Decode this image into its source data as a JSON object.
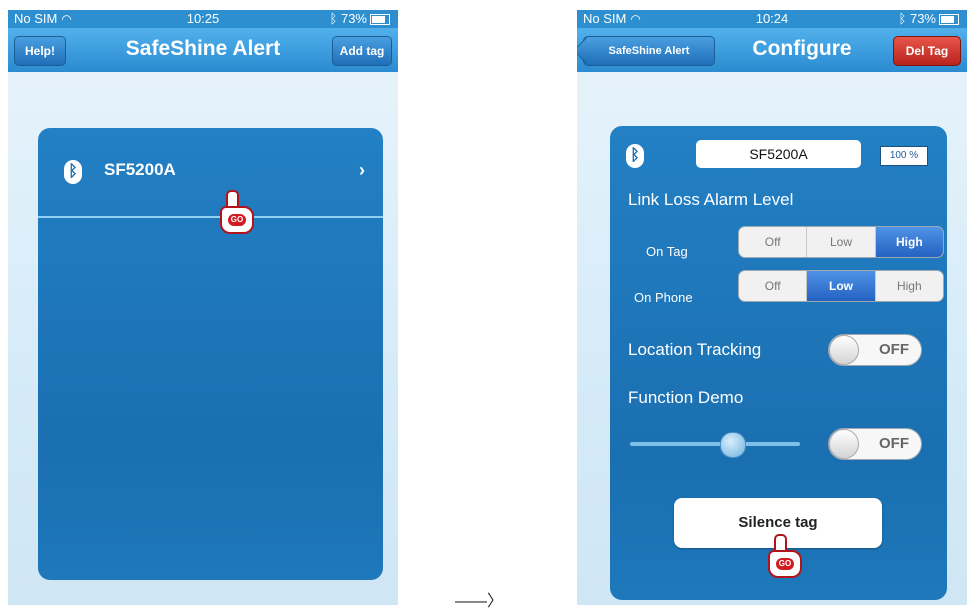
{
  "left_screen": {
    "status": {
      "carrier": "No SIM",
      "time": "10:25",
      "battery": "73%"
    },
    "nav": {
      "help_label": "Help!",
      "title": "SafeShine Alert",
      "add_label": "Add tag"
    },
    "tags": [
      {
        "name": "SF5200A"
      }
    ],
    "pointer_label": "GO"
  },
  "right_screen": {
    "status": {
      "carrier": "No SIM",
      "time": "10:24",
      "battery": "73%"
    },
    "nav": {
      "back_label": "SafeShine Alert",
      "title": "Configure",
      "del_label": "Del Tag"
    },
    "tag_name": "SF5200A",
    "battery_level": "100 %",
    "link_loss_title": "Link Loss Alarm Level",
    "on_tag_label": "On Tag",
    "on_phone_label": "On Phone",
    "segment_options": [
      "Off",
      "Low",
      "High"
    ],
    "on_tag_selected": "High",
    "on_phone_selected": "Low",
    "location_tracking_label": "Location Tracking",
    "location_tracking_state": "OFF",
    "function_demo_label": "Function Demo",
    "function_demo_state": "OFF",
    "demo_slider_value": 0.6,
    "silence_label": "Silence tag",
    "pointer_label": "GO"
  },
  "between_arrow": "——〉",
  "colors": {
    "nav_blue": "#2a8bd0",
    "panel_blue": "#1a6fb0",
    "selected_blue": "#2462c2",
    "delete_red": "#b8241c",
    "pointer_red": "#d11a22"
  },
  "icons": [
    "bluetooth-icon",
    "wifi-icon",
    "battery-icon",
    "chevron-right-icon",
    "pointing-hand-icon"
  ]
}
